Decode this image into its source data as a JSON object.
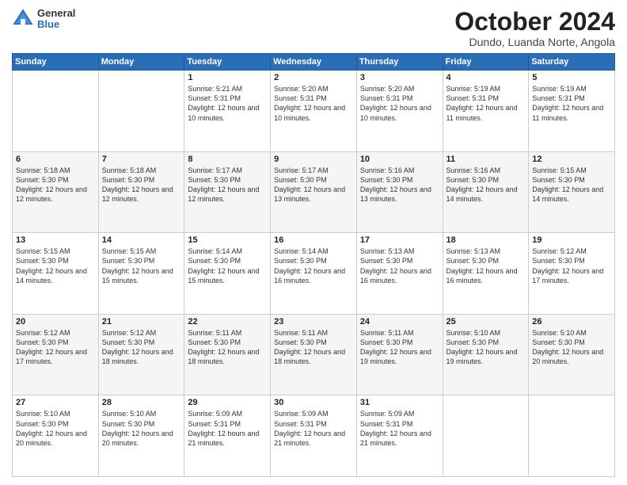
{
  "logo": {
    "general": "General",
    "blue": "Blue"
  },
  "header": {
    "month_title": "October 2024",
    "subtitle": "Dundo, Luanda Norte, Angola"
  },
  "days_of_week": [
    "Sunday",
    "Monday",
    "Tuesday",
    "Wednesday",
    "Thursday",
    "Friday",
    "Saturday"
  ],
  "weeks": [
    [
      null,
      null,
      {
        "day": "1",
        "sunrise": "Sunrise: 5:21 AM",
        "sunset": "Sunset: 5:31 PM",
        "daylight": "Daylight: 12 hours and 10 minutes."
      },
      {
        "day": "2",
        "sunrise": "Sunrise: 5:20 AM",
        "sunset": "Sunset: 5:31 PM",
        "daylight": "Daylight: 12 hours and 10 minutes."
      },
      {
        "day": "3",
        "sunrise": "Sunrise: 5:20 AM",
        "sunset": "Sunset: 5:31 PM",
        "daylight": "Daylight: 12 hours and 10 minutes."
      },
      {
        "day": "4",
        "sunrise": "Sunrise: 5:19 AM",
        "sunset": "Sunset: 5:31 PM",
        "daylight": "Daylight: 12 hours and 11 minutes."
      },
      {
        "day": "5",
        "sunrise": "Sunrise: 5:19 AM",
        "sunset": "Sunset: 5:31 PM",
        "daylight": "Daylight: 12 hours and 11 minutes."
      }
    ],
    [
      {
        "day": "6",
        "sunrise": "Sunrise: 5:18 AM",
        "sunset": "Sunset: 5:30 PM",
        "daylight": "Daylight: 12 hours and 12 minutes."
      },
      {
        "day": "7",
        "sunrise": "Sunrise: 5:18 AM",
        "sunset": "Sunset: 5:30 PM",
        "daylight": "Daylight: 12 hours and 12 minutes."
      },
      {
        "day": "8",
        "sunrise": "Sunrise: 5:17 AM",
        "sunset": "Sunset: 5:30 PM",
        "daylight": "Daylight: 12 hours and 12 minutes."
      },
      {
        "day": "9",
        "sunrise": "Sunrise: 5:17 AM",
        "sunset": "Sunset: 5:30 PM",
        "daylight": "Daylight: 12 hours and 13 minutes."
      },
      {
        "day": "10",
        "sunrise": "Sunrise: 5:16 AM",
        "sunset": "Sunset: 5:30 PM",
        "daylight": "Daylight: 12 hours and 13 minutes."
      },
      {
        "day": "11",
        "sunrise": "Sunrise: 5:16 AM",
        "sunset": "Sunset: 5:30 PM",
        "daylight": "Daylight: 12 hours and 14 minutes."
      },
      {
        "day": "12",
        "sunrise": "Sunrise: 5:15 AM",
        "sunset": "Sunset: 5:30 PM",
        "daylight": "Daylight: 12 hours and 14 minutes."
      }
    ],
    [
      {
        "day": "13",
        "sunrise": "Sunrise: 5:15 AM",
        "sunset": "Sunset: 5:30 PM",
        "daylight": "Daylight: 12 hours and 14 minutes."
      },
      {
        "day": "14",
        "sunrise": "Sunrise: 5:15 AM",
        "sunset": "Sunset: 5:30 PM",
        "daylight": "Daylight: 12 hours and 15 minutes."
      },
      {
        "day": "15",
        "sunrise": "Sunrise: 5:14 AM",
        "sunset": "Sunset: 5:30 PM",
        "daylight": "Daylight: 12 hours and 15 minutes."
      },
      {
        "day": "16",
        "sunrise": "Sunrise: 5:14 AM",
        "sunset": "Sunset: 5:30 PM",
        "daylight": "Daylight: 12 hours and 16 minutes."
      },
      {
        "day": "17",
        "sunrise": "Sunrise: 5:13 AM",
        "sunset": "Sunset: 5:30 PM",
        "daylight": "Daylight: 12 hours and 16 minutes."
      },
      {
        "day": "18",
        "sunrise": "Sunrise: 5:13 AM",
        "sunset": "Sunset: 5:30 PM",
        "daylight": "Daylight: 12 hours and 16 minutes."
      },
      {
        "day": "19",
        "sunrise": "Sunrise: 5:12 AM",
        "sunset": "Sunset: 5:30 PM",
        "daylight": "Daylight: 12 hours and 17 minutes."
      }
    ],
    [
      {
        "day": "20",
        "sunrise": "Sunrise: 5:12 AM",
        "sunset": "Sunset: 5:30 PM",
        "daylight": "Daylight: 12 hours and 17 minutes."
      },
      {
        "day": "21",
        "sunrise": "Sunrise: 5:12 AM",
        "sunset": "Sunset: 5:30 PM",
        "daylight": "Daylight: 12 hours and 18 minutes."
      },
      {
        "day": "22",
        "sunrise": "Sunrise: 5:11 AM",
        "sunset": "Sunset: 5:30 PM",
        "daylight": "Daylight: 12 hours and 18 minutes."
      },
      {
        "day": "23",
        "sunrise": "Sunrise: 5:11 AM",
        "sunset": "Sunset: 5:30 PM",
        "daylight": "Daylight: 12 hours and 18 minutes."
      },
      {
        "day": "24",
        "sunrise": "Sunrise: 5:11 AM",
        "sunset": "Sunset: 5:30 PM",
        "daylight": "Daylight: 12 hours and 19 minutes."
      },
      {
        "day": "25",
        "sunrise": "Sunrise: 5:10 AM",
        "sunset": "Sunset: 5:30 PM",
        "daylight": "Daylight: 12 hours and 19 minutes."
      },
      {
        "day": "26",
        "sunrise": "Sunrise: 5:10 AM",
        "sunset": "Sunset: 5:30 PM",
        "daylight": "Daylight: 12 hours and 20 minutes."
      }
    ],
    [
      {
        "day": "27",
        "sunrise": "Sunrise: 5:10 AM",
        "sunset": "Sunset: 5:30 PM",
        "daylight": "Daylight: 12 hours and 20 minutes."
      },
      {
        "day": "28",
        "sunrise": "Sunrise: 5:10 AM",
        "sunset": "Sunset: 5:30 PM",
        "daylight": "Daylight: 12 hours and 20 minutes."
      },
      {
        "day": "29",
        "sunrise": "Sunrise: 5:09 AM",
        "sunset": "Sunset: 5:31 PM",
        "daylight": "Daylight: 12 hours and 21 minutes."
      },
      {
        "day": "30",
        "sunrise": "Sunrise: 5:09 AM",
        "sunset": "Sunset: 5:31 PM",
        "daylight": "Daylight: 12 hours and 21 minutes."
      },
      {
        "day": "31",
        "sunrise": "Sunrise: 5:09 AM",
        "sunset": "Sunset: 5:31 PM",
        "daylight": "Daylight: 12 hours and 21 minutes."
      },
      null,
      null
    ]
  ]
}
